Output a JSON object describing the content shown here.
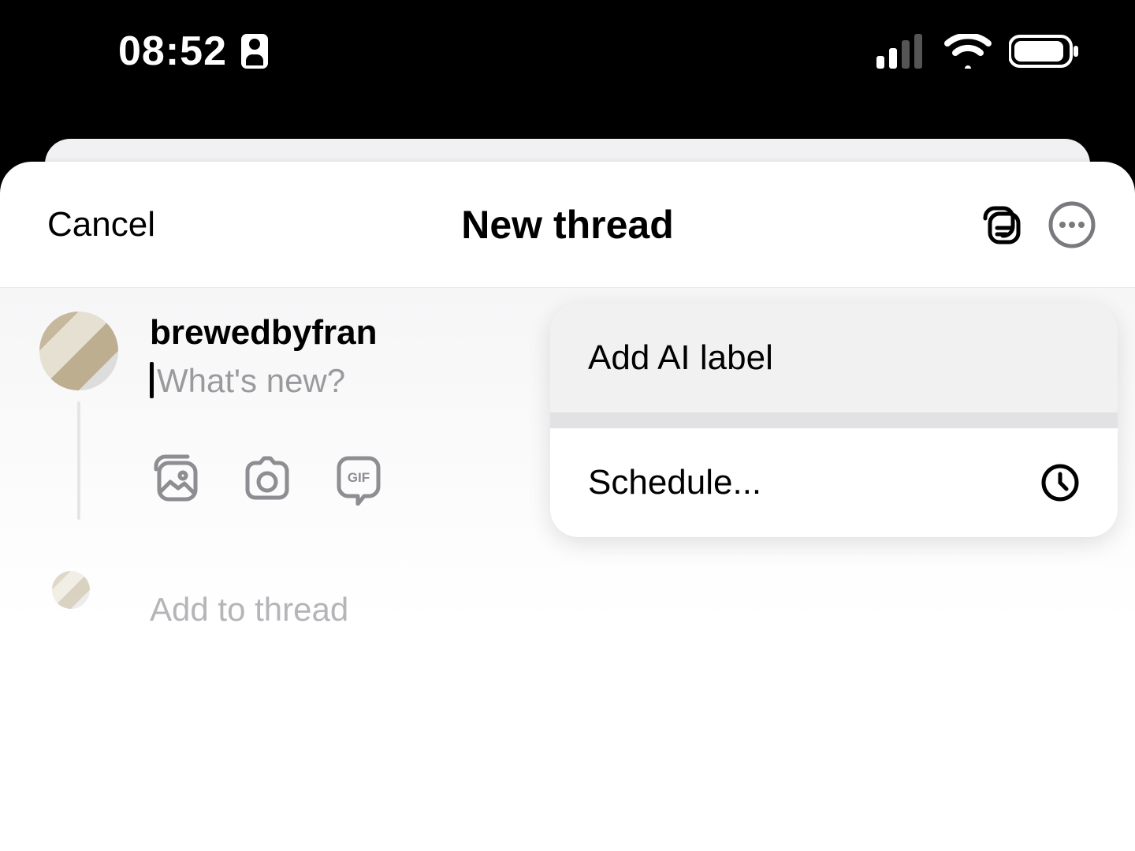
{
  "statusbar": {
    "time": "08:52"
  },
  "header": {
    "cancel_label": "Cancel",
    "title": "New thread"
  },
  "composer": {
    "username": "brewedbyfran",
    "placeholder": "What's new?",
    "add_to_thread_label": "Add to thread"
  },
  "menu": {
    "ai_label": "Add AI label",
    "schedule_label": "Schedule..."
  }
}
